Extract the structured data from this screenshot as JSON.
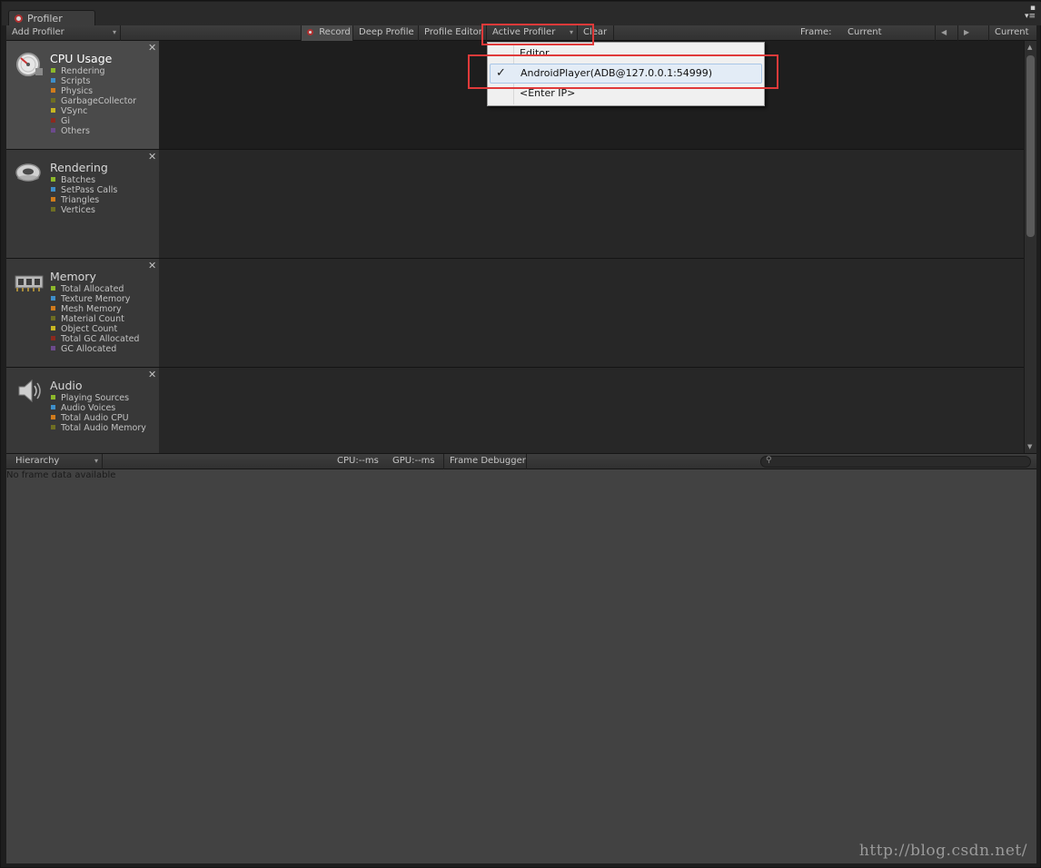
{
  "window": {
    "tab_title": "Profiler",
    "controls": "▪\n▾≡"
  },
  "toolbar": {
    "add_profiler": "Add Profiler",
    "record": "Record",
    "deep_profile": "Deep Profile",
    "profile_editor": "Profile Editor",
    "active_profiler": "Active Profiler",
    "clear": "Clear",
    "frame_label": "Frame:",
    "frame_value": "Current",
    "prev_icon": "◀",
    "next_icon": "▶",
    "current": "Current"
  },
  "modules": [
    {
      "title": "CPU Usage",
      "icon": "cpu-usage-icon",
      "items": [
        {
          "label": "Rendering",
          "color": "#8cb82b"
        },
        {
          "label": "Scripts",
          "color": "#3e8ec9"
        },
        {
          "label": "Physics",
          "color": "#d07b1c"
        },
        {
          "label": "GarbageCollector",
          "color": "#6e6e23"
        },
        {
          "label": "VSync",
          "color": "#c7b622"
        },
        {
          "label": "Gi",
          "color": "#8c2a1f"
        },
        {
          "label": "Others",
          "color": "#6c4a8c"
        }
      ]
    },
    {
      "title": "Rendering",
      "icon": "rendering-icon",
      "items": [
        {
          "label": "Batches",
          "color": "#8cb82b"
        },
        {
          "label": "SetPass Calls",
          "color": "#3e8ec9"
        },
        {
          "label": "Triangles",
          "color": "#d07b1c"
        },
        {
          "label": "Vertices",
          "color": "#6e6e23"
        }
      ]
    },
    {
      "title": "Memory",
      "icon": "memory-icon",
      "items": [
        {
          "label": "Total Allocated",
          "color": "#8cb82b"
        },
        {
          "label": "Texture Memory",
          "color": "#3e8ec9"
        },
        {
          "label": "Mesh Memory",
          "color": "#d07b1c"
        },
        {
          "label": "Material Count",
          "color": "#6e6e23"
        },
        {
          "label": "Object Count",
          "color": "#c7b622"
        },
        {
          "label": "Total GC Allocated",
          "color": "#8c2a1f"
        },
        {
          "label": "GC Allocated",
          "color": "#6c4a8c"
        }
      ]
    },
    {
      "title": "Audio",
      "icon": "audio-icon",
      "items": [
        {
          "label": "Playing Sources",
          "color": "#8cb82b"
        },
        {
          "label": "Audio Voices",
          "color": "#3e8ec9"
        },
        {
          "label": "Total Audio CPU",
          "color": "#d07b1c"
        },
        {
          "label": "Total Audio Memory",
          "color": "#6e6e23"
        }
      ]
    }
  ],
  "hierarchy_bar": {
    "view": "Hierarchy",
    "cpu": "CPU:--ms",
    "gpu": "GPU:--ms",
    "frame_debugger": "Frame Debugger",
    "search_placeholder": ""
  },
  "detail": {
    "message": "No frame data available",
    "watermark": "http://blog.csdn.net/"
  },
  "dropdown": {
    "items": [
      {
        "label": "Editor",
        "checked": false
      },
      {
        "label": "AndroidPlayer(ADB@127.0.0.1:54999)",
        "checked": true
      },
      {
        "label": "<Enter IP>",
        "checked": false
      }
    ],
    "check_mark": "✓"
  },
  "colors": {
    "annotation": "#e03a3a",
    "selected_item_bg": "#e3ecf6"
  }
}
